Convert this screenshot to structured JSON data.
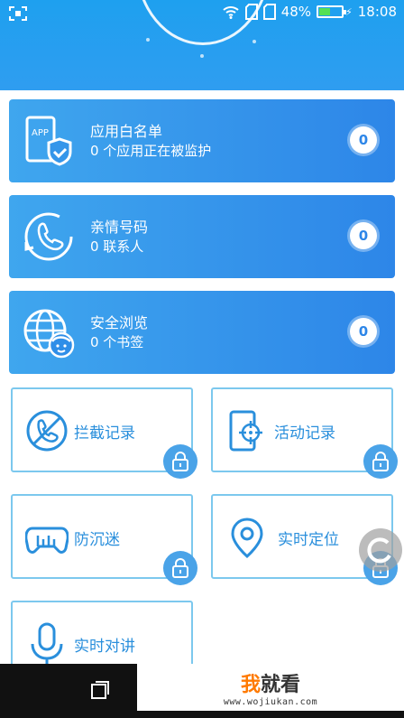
{
  "status_bar": {
    "battery": "48%",
    "time": "18:08",
    "battery_level": 0.48
  },
  "cards": [
    {
      "title": "应用白名单",
      "sub": "0 个应用正在被监护",
      "count": "0",
      "icon": "app-shield-icon"
    },
    {
      "title": "亲情号码",
      "sub": "0 联系人",
      "count": "0",
      "icon": "phone-contact-icon"
    },
    {
      "title": "安全浏览",
      "sub": "0 个书签",
      "count": "0",
      "icon": "globe-child-icon"
    }
  ],
  "tiles": [
    {
      "label": "拦截记录",
      "icon": "blocked-call-icon",
      "locked": true
    },
    {
      "label": "活动记录",
      "icon": "phone-target-icon",
      "locked": true
    },
    {
      "label": "防沉迷",
      "icon": "gamepad-icon",
      "locked": true
    },
    {
      "label": "实时定位",
      "icon": "location-pin-icon",
      "locked": true
    },
    {
      "label": "实时对讲",
      "icon": "microphone-icon",
      "locked": false
    }
  ],
  "watermark": {
    "title_prefix": "我",
    "title_rest": "就看",
    "url": "www.wojiukan.com"
  },
  "colors": {
    "primary": "#2d86e8",
    "tile_border": "#7cc8ee",
    "lock": "#4aa3e8"
  }
}
